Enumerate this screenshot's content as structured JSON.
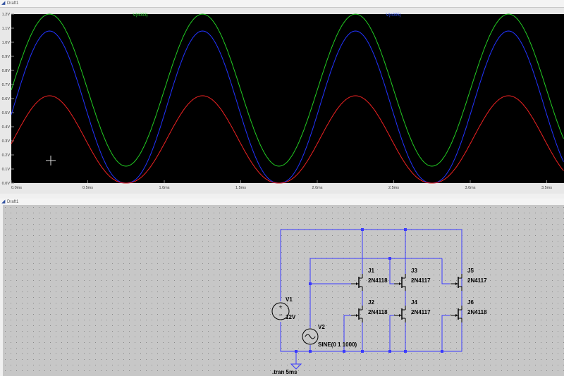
{
  "windows": {
    "waveform_title": "Draft1",
    "schematic_title": "Draft1"
  },
  "chart_data": {
    "type": "line",
    "xlim": [
      0,
      3.6
    ],
    "ylim": [
      0,
      1.2
    ],
    "x_ticks": [
      "0.0ms",
      "0.5ms",
      "1.0ms",
      "1.5ms",
      "2.0ms",
      "2.5ms",
      "3.0ms",
      "3.5ms"
    ],
    "y_ticks": [
      "0.0V",
      "0.1V",
      "0.2V",
      "0.3V",
      "0.4V",
      "0.5V",
      "0.6V",
      "0.7V",
      "0.8V",
      "0.9V",
      "1.0V",
      "1.1V",
      "1.2V"
    ],
    "grid": false,
    "series": [
      {
        "name": "V(n003)",
        "color": "#22cc22",
        "period_ms": 1.0,
        "peak_time_ms": 0.25,
        "min": 0.12,
        "max": 1.2
      },
      {
        "name": "V(n005)",
        "color": "#2233ff",
        "period_ms": 1.0,
        "peak_time_ms": 0.25,
        "min": 0.0,
        "max": 1.08
      },
      {
        "name": "",
        "color": "#ee2222",
        "period_ms": 1.0,
        "peak_time_ms": 0.25,
        "min": 0.0,
        "max": 0.62
      }
    ],
    "legend": [
      {
        "label": "V(n003)",
        "color": "#33dd33"
      },
      {
        "label": "V(n005)",
        "color": "#3355ff"
      }
    ]
  },
  "schematic": {
    "v1": {
      "name": "V1",
      "value": "12V"
    },
    "v2": {
      "name": "V2",
      "value": "SINE(0 1 1000)"
    },
    "jfets": [
      {
        "name": "J1",
        "model": "2N4118"
      },
      {
        "name": "J2",
        "model": "2N4118"
      },
      {
        "name": "J3",
        "model": "2N4117"
      },
      {
        "name": "J4",
        "model": "2N4117"
      },
      {
        "name": "J5",
        "model": "2N4117"
      },
      {
        "name": "J6",
        "model": "2N4118"
      }
    ],
    "directive": ".tran 5ms",
    "wire_color": "#3b3bff",
    "background_color": "#c7c7c7"
  }
}
